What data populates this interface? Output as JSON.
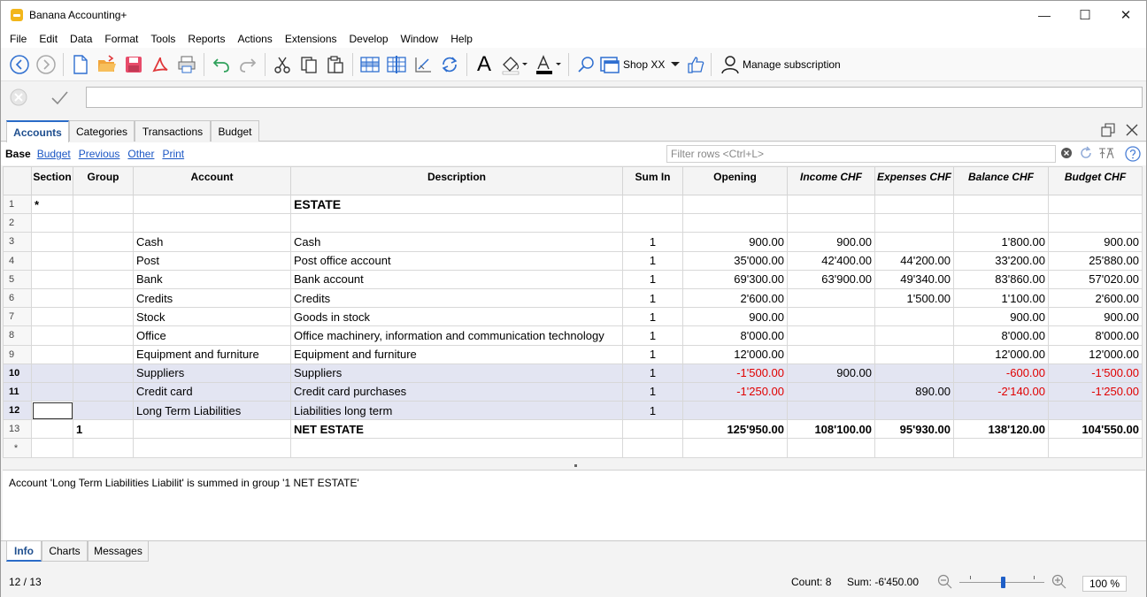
{
  "window": {
    "title": "Banana Accounting+",
    "minimize_glyph": "—",
    "maximize_glyph": "☐",
    "close_glyph": "✕"
  },
  "menu": [
    "File",
    "Edit",
    "Data",
    "Format",
    "Tools",
    "Reports",
    "Actions",
    "Extensions",
    "Develop",
    "Window",
    "Help"
  ],
  "toolbar": {
    "shop_label": "Shop XX",
    "subscription_label": "Manage subscription",
    "font_glyph": "A"
  },
  "tabs": [
    "Accounts",
    "Categories",
    "Transactions",
    "Budget"
  ],
  "views": {
    "active": "Base",
    "links": [
      "Budget",
      "Previous",
      "Other",
      "Print"
    ]
  },
  "filter": {
    "placeholder": "Filter rows <Ctrl+L>"
  },
  "columns": [
    "Section",
    "Group",
    "Account",
    "Description",
    "Sum In",
    "Opening",
    "Income CHF",
    "Expenses CHF",
    "Balance CHF",
    "Budget CHF"
  ],
  "rows": [
    {
      "n": "1",
      "section": "*",
      "group": "",
      "account": "",
      "description": "ESTATE",
      "sumin": "",
      "opening": "",
      "income": "",
      "expenses": "",
      "balance": "",
      "budget": ""
    },
    {
      "n": "2",
      "section": "",
      "group": "",
      "account": "",
      "description": "",
      "sumin": "",
      "opening": "",
      "income": "",
      "expenses": "",
      "balance": "",
      "budget": ""
    },
    {
      "n": "3",
      "section": "",
      "group": "",
      "account": "Cash",
      "description": "Cash",
      "sumin": "1",
      "opening": "900.00",
      "income": "900.00",
      "expenses": "",
      "balance": "1'800.00",
      "budget": "900.00"
    },
    {
      "n": "4",
      "section": "",
      "group": "",
      "account": "Post",
      "description": "Post office account",
      "sumin": "1",
      "opening": "35'000.00",
      "income": "42'400.00",
      "expenses": "44'200.00",
      "balance": "33'200.00",
      "budget": "25'880.00"
    },
    {
      "n": "5",
      "section": "",
      "group": "",
      "account": "Bank",
      "description": "Bank account",
      "sumin": "1",
      "opening": "69'300.00",
      "income": "63'900.00",
      "expenses": "49'340.00",
      "balance": "83'860.00",
      "budget": "57'020.00"
    },
    {
      "n": "6",
      "section": "",
      "group": "",
      "account": "Credits",
      "description": "Credits",
      "sumin": "1",
      "opening": "2'600.00",
      "income": "",
      "expenses": "1'500.00",
      "balance": "1'100.00",
      "budget": "2'600.00"
    },
    {
      "n": "7",
      "section": "",
      "group": "",
      "account": "Stock",
      "description": "Goods in stock",
      "sumin": "1",
      "opening": "900.00",
      "income": "",
      "expenses": "",
      "balance": "900.00",
      "budget": "900.00"
    },
    {
      "n": "8",
      "section": "",
      "group": "",
      "account": "Office",
      "description": "Office machinery, information and communication technology",
      "sumin": "1",
      "opening": "8'000.00",
      "income": "",
      "expenses": "",
      "balance": "8'000.00",
      "budget": "8'000.00"
    },
    {
      "n": "9",
      "section": "",
      "group": "",
      "account": "Equipment and furniture",
      "description": "Equipment and furniture",
      "sumin": "1",
      "opening": "12'000.00",
      "income": "",
      "expenses": "",
      "balance": "12'000.00",
      "budget": "12'000.00"
    },
    {
      "n": "10",
      "section": "",
      "group": "",
      "account": "Suppliers",
      "description": "Suppliers",
      "sumin": "1",
      "opening": "-1'500.00",
      "income": "900.00",
      "expenses": "",
      "balance": "-600.00",
      "budget": "-1'500.00"
    },
    {
      "n": "11",
      "section": "",
      "group": "",
      "account": "Credit card",
      "description": "Credit card purchases",
      "sumin": "1",
      "opening": "-1'250.00",
      "income": "",
      "expenses": "890.00",
      "balance": "-2'140.00",
      "budget": "-1'250.00"
    },
    {
      "n": "12",
      "section": "",
      "group": "",
      "account": "Long Term Liabilities",
      "description": "Liabilities long term",
      "sumin": "1",
      "opening": "",
      "income": "",
      "expenses": "",
      "balance": "",
      "budget": ""
    },
    {
      "n": "13",
      "section": "",
      "group": "1",
      "account": "",
      "description": "NET ESTATE",
      "sumin": "",
      "opening": "125'950.00",
      "income": "108'100.00",
      "expenses": "95'930.00",
      "balance": "138'120.00",
      "budget": "104'550.00"
    },
    {
      "n": "*",
      "section": "",
      "group": "",
      "account": "",
      "description": "",
      "sumin": "",
      "opening": "",
      "income": "",
      "expenses": "",
      "balance": "",
      "budget": ""
    }
  ],
  "info": {
    "message": "Account 'Long Term Liabilities Liabilit' is summed in group '1 NET ESTATE'"
  },
  "bottom_tabs": [
    "Info",
    "Charts",
    "Messages"
  ],
  "status": {
    "position": "12 / 13",
    "count": "Count: 8",
    "sum": "Sum: -6'450.00",
    "zoom": "100 %",
    "zoom_fraction": 0.75
  },
  "colors": {
    "accent": "#2a6bc8",
    "negative": "#e00000",
    "selected_row": "#e3e5f2",
    "link": "#1a56c4"
  }
}
